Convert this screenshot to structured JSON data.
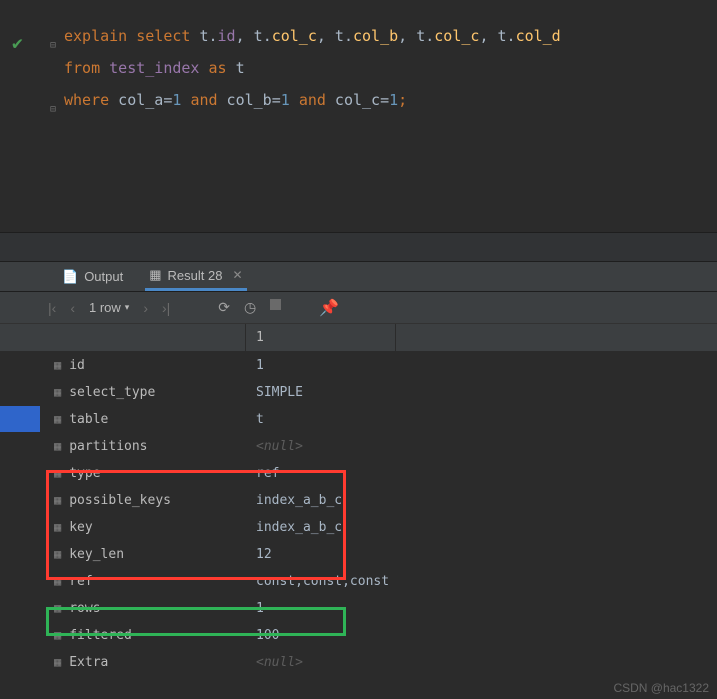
{
  "editor": {
    "lines": [
      {
        "html": "<span class='kw'>explain</span> <span class='kw'>select</span> t<span class='dot'>.</span><span class='tbl'>id</span><span class='dot'>,</span> t<span class='dot'>.</span><span class='col'>col_c</span><span class='dot'>,</span> t<span class='dot'>.</span><span class='col'>col_b</span><span class='dot'>,</span> t<span class='dot'>.</span><span class='col'>col_c</span><span class='dot'>,</span> t<span class='dot'>.</span><span class='col'>col_d</span>"
      },
      {
        "html": "<span class='kw'>from</span> <span class='tbl'>test_index</span> <span class='kw'>as</span> t"
      },
      {
        "html": "<span class='kw'>where</span> col_a<span class='op'>=</span><span class='num'>1</span> <span class='kw'>and</span> col_b<span class='op'>=</span><span class='num'>1</span> <span class='kw'>and</span> col_c<span class='op'>=</span><span class='num'>1</span><span class='semi'>;</span>"
      }
    ]
  },
  "tabs": {
    "output": "Output",
    "result": "Result 28"
  },
  "toolbar": {
    "row_count": "1 row"
  },
  "grid": {
    "header_col": "1",
    "rows": [
      {
        "label": "id",
        "value": "1",
        "null": false
      },
      {
        "label": "select_type",
        "value": "SIMPLE",
        "null": false
      },
      {
        "label": "table",
        "value": "t",
        "null": false
      },
      {
        "label": "partitions",
        "value": "<null>",
        "null": true
      },
      {
        "label": "type",
        "value": "ref",
        "null": false
      },
      {
        "label": "possible_keys",
        "value": "index_a_b_c",
        "null": false
      },
      {
        "label": "key",
        "value": "index_a_b_c",
        "null": false
      },
      {
        "label": "key_len",
        "value": "12",
        "null": false
      },
      {
        "label": "ref",
        "value": "const,const,const",
        "null": false
      },
      {
        "label": "rows",
        "value": "1",
        "null": false
      },
      {
        "label": "filtered",
        "value": "100",
        "null": false
      },
      {
        "label": "Extra",
        "value": "<null>",
        "null": true
      }
    ]
  },
  "watermark": "CSDN @hac1322"
}
